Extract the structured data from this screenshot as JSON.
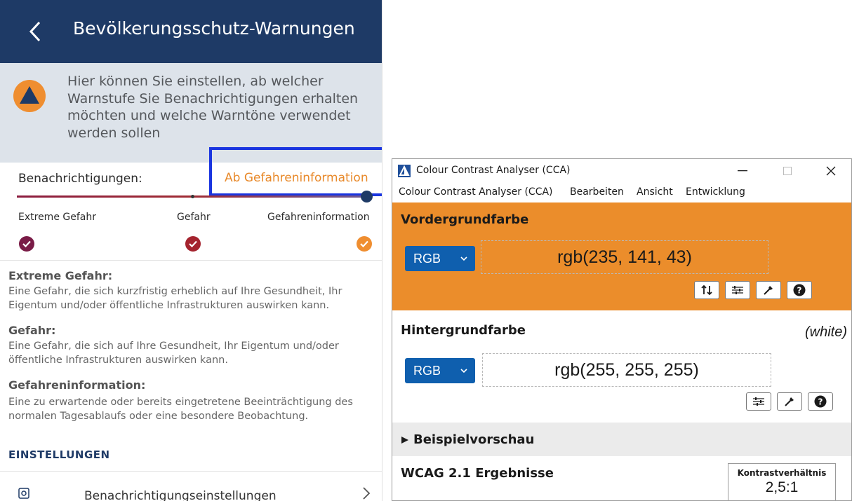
{
  "app": {
    "title": "Bevölkerungsschutz-Warnungen",
    "info_text": "Hier können Sie einstellen, ab welcher Warnstufe Sie Benachrichtigungen erhalten möchten und welche Warntöne verwendet werden sollen",
    "notifications": {
      "label": "Benachrichtigungen:",
      "value": "Ab Gefahreninformation"
    },
    "levels": [
      {
        "label": "Extreme Gefahr",
        "color": "#7a1c47"
      },
      {
        "label": "Gefahr",
        "color": "#a4232e"
      },
      {
        "label": "Gefahreninformation",
        "color": "#ef8e30"
      }
    ],
    "descriptions": [
      {
        "title": "Extreme Gefahr:",
        "text": "Eine Gefahr, die sich kurzfristig erheblich auf Ihre Gesundheit, Ihr Eigentum und/oder öffentliche Infrastrukturen auswirken kann."
      },
      {
        "title": "Gefahr:",
        "text": "Eine Gefahr, die sich auf Ihre Gesundheit, Ihr Eigentum und/oder öffentliche Infrastrukturen auswirken kann."
      },
      {
        "title": "Gefahreninformation:",
        "text": "Eine zu erwartende oder bereits eingetretene Beeinträchtigung des normalen Tagesablaufs oder eine besondere Beobachtung."
      }
    ],
    "settings_heading": "EINSTELLUNGEN",
    "settings_item": "Benachrichtigungseinstellungen",
    "header_color": "#1e3a66",
    "accent_color": "#e8892a"
  },
  "cca": {
    "window_title": "Colour Contrast Analyser (CCA)",
    "menu": [
      "Colour Contrast Analyser (CCA)",
      "Bearbeiten",
      "Ansicht",
      "Entwicklung"
    ],
    "foreground": {
      "title": "Vordergrundfarbe",
      "format": "RGB",
      "value": "rgb(235, 141, 43)",
      "color": "#eb8d2b"
    },
    "background": {
      "title": "Hintergrundfarbe",
      "hint": "(white)",
      "format": "RGB",
      "value": "rgb(255, 255, 255)"
    },
    "preview_label": "Beispielvorschau",
    "results_title": "WCAG 2.1 Ergebnisse",
    "ratio_label": "Kontrastverhältnis",
    "ratio_value": "2,5:1"
  }
}
